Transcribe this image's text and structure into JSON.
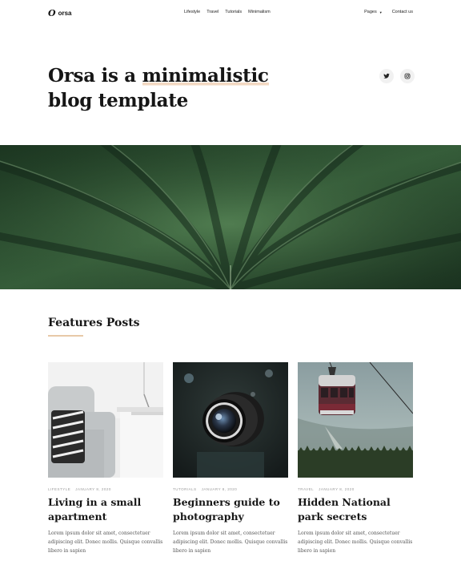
{
  "nav": {
    "logo_mark": "O",
    "logo_text": "orsa",
    "links": [
      "Lifestyle",
      "Travel",
      "Tutorials",
      "Minimalism"
    ],
    "pages_label": "Pages",
    "contact_label": "Contact us"
  },
  "hero": {
    "title_before": "Orsa is a ",
    "title_highlight": "minimalistic",
    "title_after": "blog template",
    "social": [
      "twitter-icon",
      "instagram-icon"
    ]
  },
  "section": {
    "title": "Features Posts"
  },
  "posts": [
    {
      "category": "Lifestyle",
      "date": "January 8, 2020",
      "title": "Living in a small apartment",
      "excerpt": "Lorem ipsum dolor sit amet, consectetuer adipiscing elit. Donec mollis. Quisque convallis libero in sapien"
    },
    {
      "category": "Tutorials",
      "date": "January 8, 2020",
      "title": "Beginners guide to photography",
      "excerpt": "Lorem ipsum dolor sit amet, consectetuer adipiscing elit. Donec mollis. Quisque convallis libero in sapien"
    },
    {
      "category": "Travel",
      "date": "January 8, 2020",
      "title": "Hidden National park secrets",
      "excerpt": "Lorem ipsum dolor sit amet, consectetuer adipiscing elit. Donec mollis. Quisque convallis libero in sapien"
    }
  ]
}
